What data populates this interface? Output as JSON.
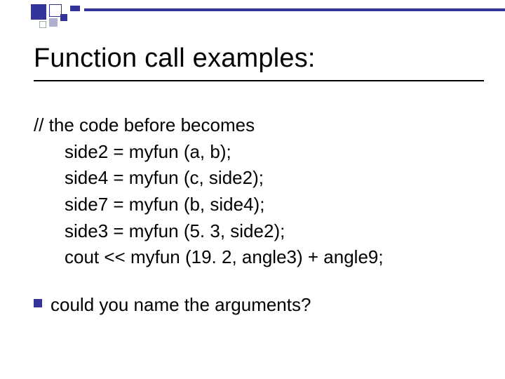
{
  "title": "Function call examples:",
  "code": {
    "comment": "// the code before becomes",
    "lines": [
      "side2 = myfun (a, b);",
      "side4 = myfun (c, side2);",
      "side7 = myfun (b, side4);",
      "side3 = myfun (5. 3, side2);",
      "cout << myfun (19. 2, angle3) + angle9;"
    ]
  },
  "bullet": "could you name the arguments?"
}
